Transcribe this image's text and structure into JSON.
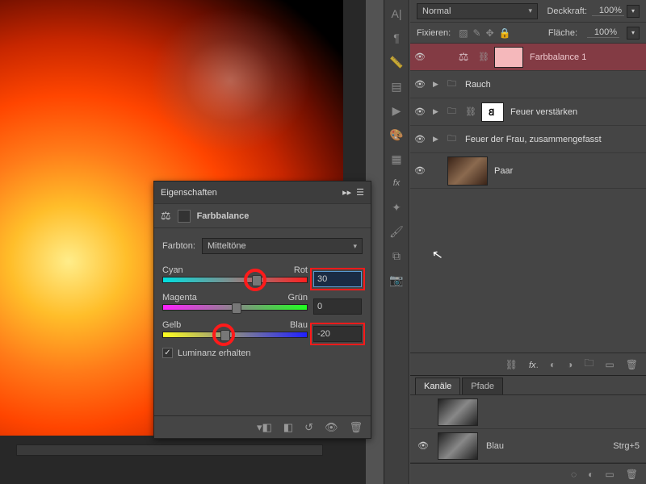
{
  "layers_panel": {
    "blend_mode": "Normal",
    "opacity_label": "Deckkraft:",
    "opacity_value": "100%",
    "lock_label": "Fixieren:",
    "fill_label": "Fläche:",
    "fill_value": "100%",
    "layers": [
      {
        "name": "Farbbalance 1",
        "type": "adj",
        "selected": true
      },
      {
        "name": "Rauch",
        "type": "group"
      },
      {
        "name": "Feuer verstärken",
        "type": "group_masked"
      },
      {
        "name": "Feuer der Frau, zusammengefasst",
        "type": "group"
      },
      {
        "name": "Paar",
        "type": "photo"
      }
    ]
  },
  "channels": {
    "tab1": "Kanäle",
    "tab2": "Pfade",
    "rows": [
      {
        "name": "",
        "shortcut": ""
      },
      {
        "name": "Blau",
        "shortcut": "Strg+5"
      }
    ]
  },
  "properties": {
    "panel_title": "Eigenschaften",
    "adj_title": "Farbbalance",
    "tone_label": "Farbton:",
    "tone_value": "Mitteltöne",
    "sliders": {
      "cr": {
        "left": "Cyan",
        "right": "Rot",
        "value": "30",
        "pos": 62
      },
      "mg": {
        "left": "Magenta",
        "right": "Grün",
        "value": "0",
        "pos": 50
      },
      "yb": {
        "left": "Gelb",
        "right": "Blau",
        "value": "-20",
        "pos": 42
      }
    },
    "luminance_label": "Luminanz erhalten"
  }
}
